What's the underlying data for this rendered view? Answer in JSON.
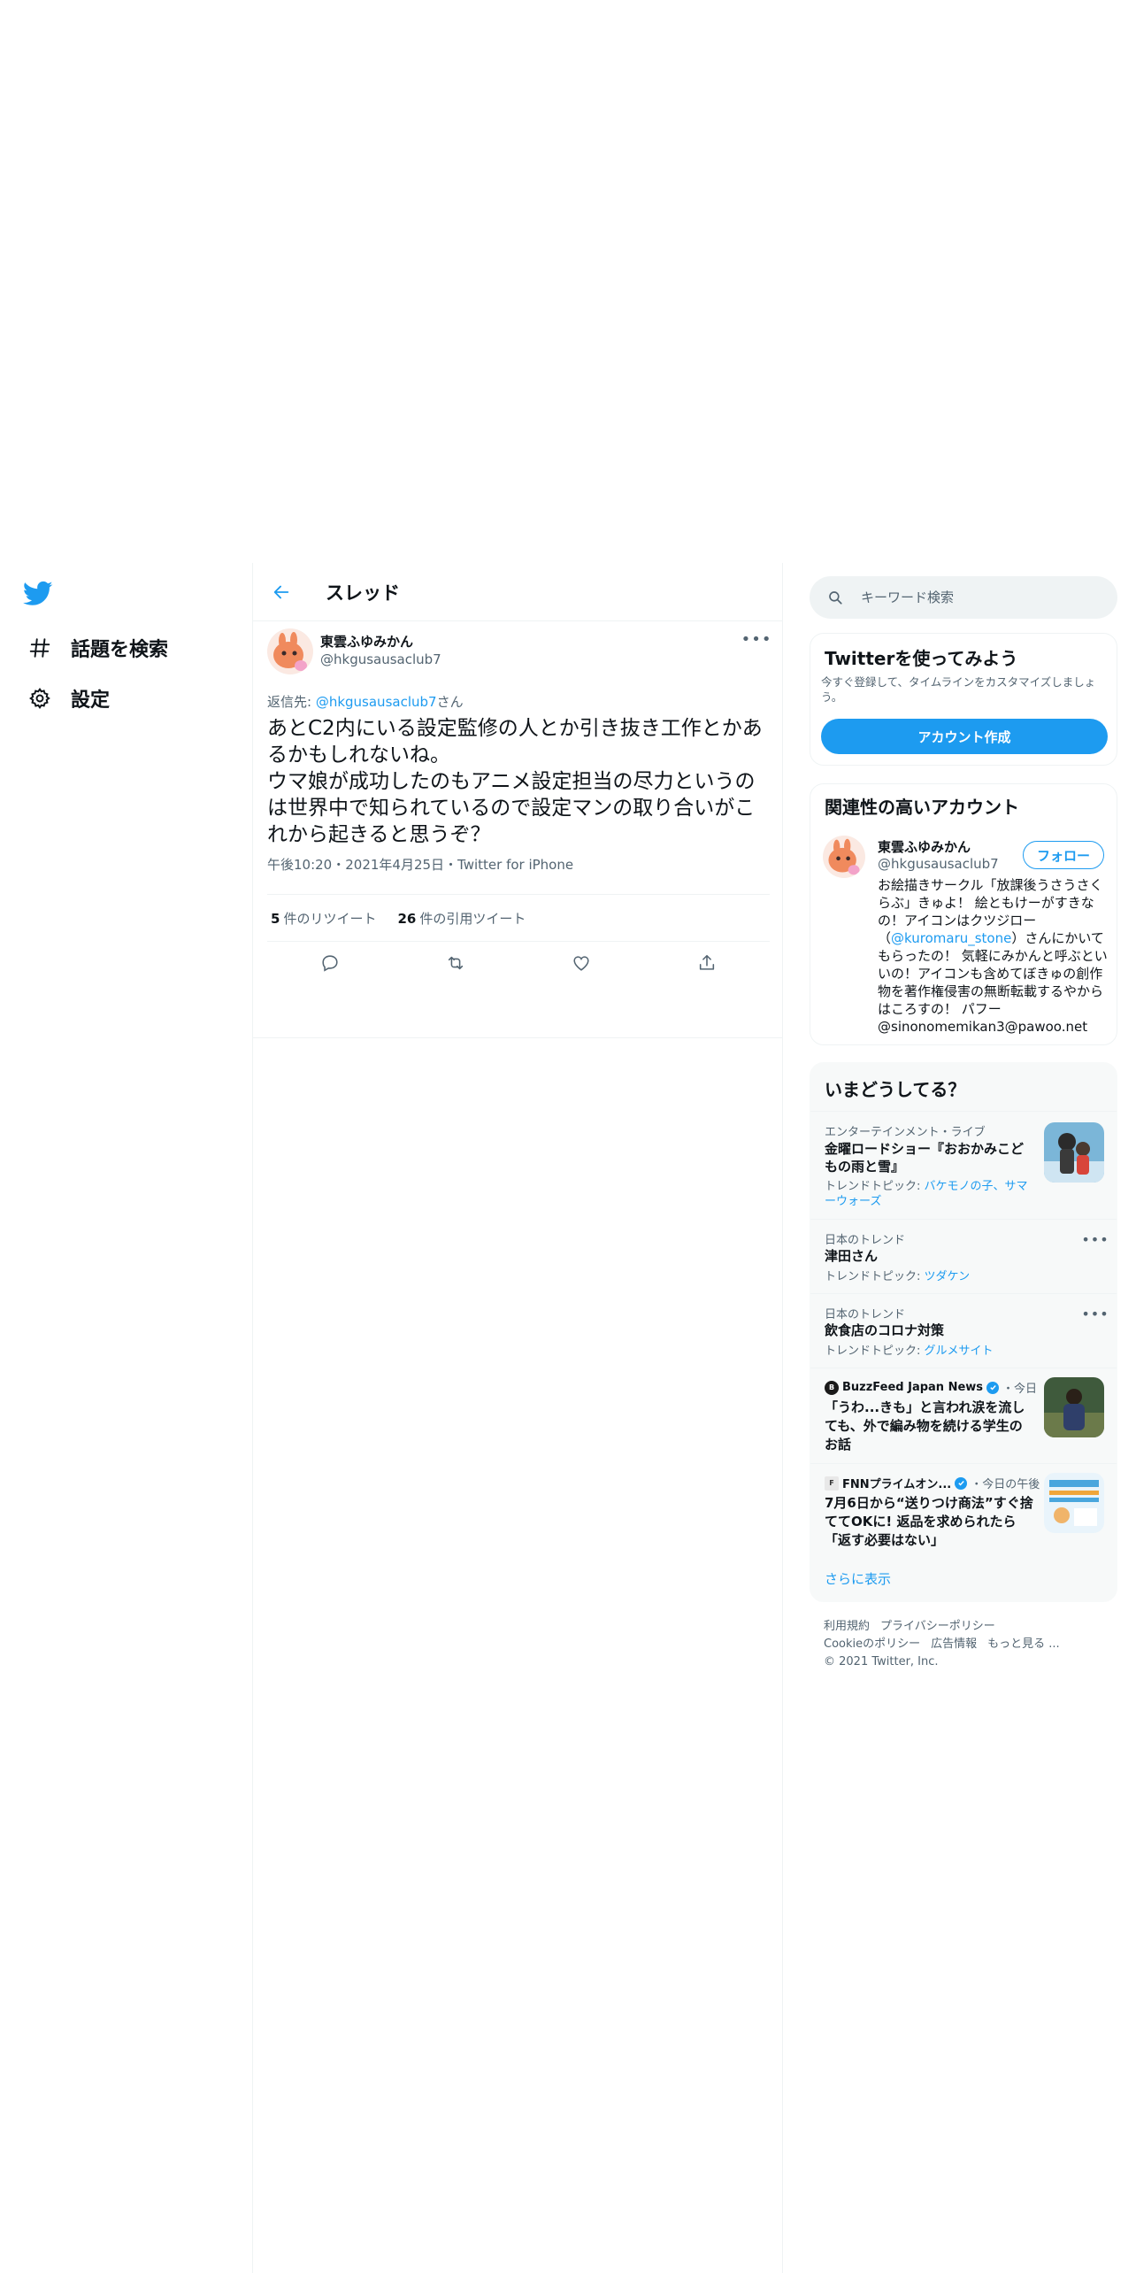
{
  "nav": {
    "items": [
      {
        "label": "話題を検索",
        "icon": "hashtag-icon"
      },
      {
        "label": "設定",
        "icon": "gear-icon"
      }
    ]
  },
  "header": {
    "title": "スレッド"
  },
  "tweet": {
    "author_name": "東雲ふゆみかん",
    "author_handle": "@hkgusausaclub7",
    "reply_prefix": "返信先: ",
    "reply_to": "@hkgusausaclub7",
    "reply_suffix": "さん",
    "text": "あとC2内にいる設定監修の人とか引き抜き工作とかあるかもしれないね。\nウマ娘が成功したのもアニメ設定担当の尽力というのは世界中で知られているので設定マンの取り合いがこれから起きると思うぞ？",
    "meta": "午後10:20・2021年4月25日・Twitter for iPhone",
    "retweets_count": "5",
    "retweets_label": "件のリツイート",
    "quotes_count": "26",
    "quotes_label": "件の引用ツイート"
  },
  "search": {
    "placeholder": "キーワード検索"
  },
  "signup": {
    "title": "Twitterを使ってみよう",
    "desc": "今すぐ登録して、タイムラインをカスタマイズしましょう。",
    "button": "アカウント作成"
  },
  "related": {
    "title": "関連性の高いアカウント",
    "name": "東雲ふゆみかん",
    "handle": "@hkgusausaclub7",
    "follow": "フォロー",
    "bio_1": "お絵描きサークル「放課後うさうさくらぶ」きゅよ！ 絵ともけーがすきなの！アイコンはクツジロー（",
    "bio_link": "@kuromaru_stone",
    "bio_2": "）さんにかいてもらったの！ 気軽にみかんと呼ぶといいの！アイコンも含めてぼきゅの創作物を著作権侵害の無断転載するやからはころすの！ パフー@sinonomemikan3@pawoo.net"
  },
  "trends": {
    "title": "いまどうしてる？",
    "items": [
      {
        "category": "エンターテインメント・ライブ",
        "name": "金曜ロードショー『おおかみこどもの雨と雪』",
        "topic_prefix": "トレンドトピック: ",
        "topic": "バケモノの子、サマーウォーズ"
      },
      {
        "category": "日本のトレンド",
        "name": "津田さん",
        "topic_prefix": "トレンドトピック: ",
        "topic": "ツダケン"
      },
      {
        "category": "日本のトレンド",
        "name": "飲食店のコロナ対策",
        "topic_prefix": "トレンドトピック: ",
        "topic": "グルメサイト"
      },
      {
        "source": "BuzzFeed Japan News",
        "time": "・今日",
        "name": "「うわ...きも」と言われ涙を流しても、外で編み物を続ける学生のお話"
      },
      {
        "source": "FNNプライムオン...",
        "time": "・今日の午後",
        "name": "7月6日から“送りつけ商法”すぐ捨ててOKに! 返品を求められたら「返す必要はない」"
      }
    ],
    "show_more": "さらに表示"
  },
  "footer": {
    "links": [
      "利用規約",
      "プライバシーポリシー",
      "Cookieのポリシー",
      "広告情報",
      "もっと見る ..."
    ],
    "copyright": "© 2021 Twitter, Inc."
  },
  "colors": {
    "accent": "#1d9bf0",
    "text": "#0f1419",
    "muted": "#536471",
    "border": "#eff3f4"
  }
}
